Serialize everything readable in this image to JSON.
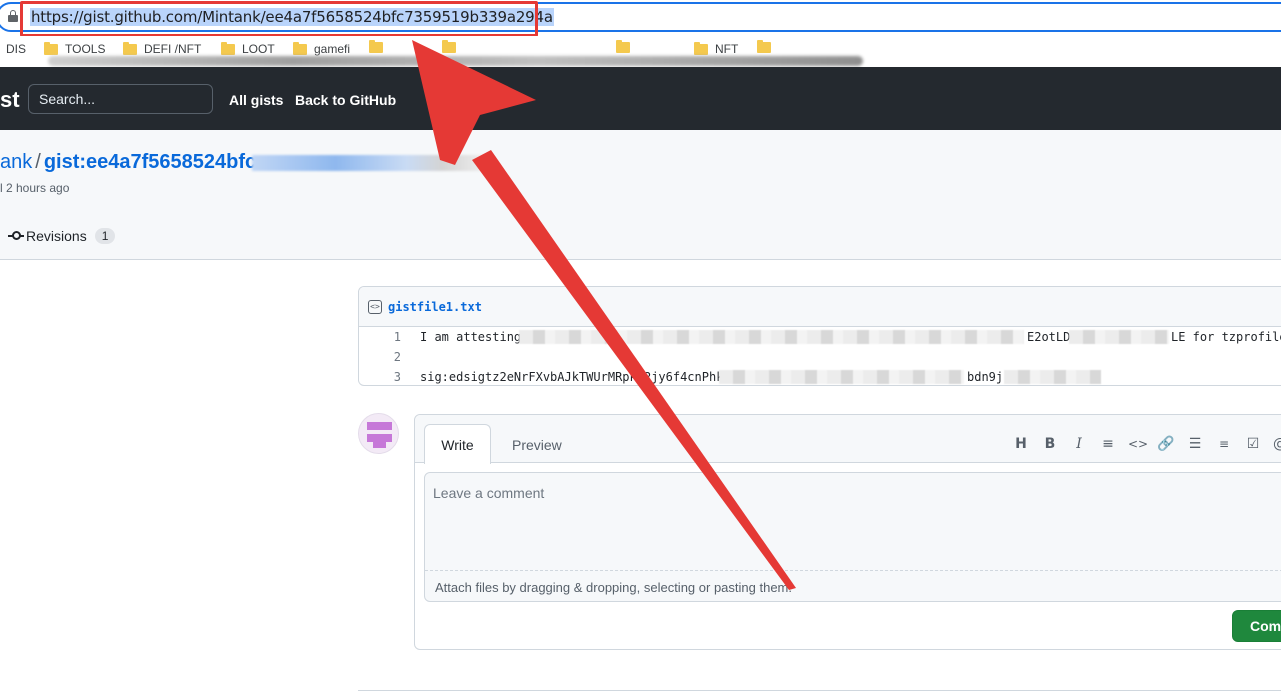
{
  "browser": {
    "url": "https://gist.github.com/Mintank/ee4a7f5658524bfc7359519b339a294a",
    "bookmarks": [
      {
        "label": "DIS",
        "folder": false
      },
      {
        "label": "TOOLS",
        "folder": true
      },
      {
        "label": "DEFI /NFT",
        "folder": true
      },
      {
        "label": "LOOT",
        "folder": true
      },
      {
        "label": "gamefi",
        "folder": true
      },
      {
        "label": "",
        "folder": true
      },
      {
        "label": "",
        "folder": true
      },
      {
        "label": "",
        "folder": true
      },
      {
        "label": "NFT",
        "folder": true
      },
      {
        "label": "",
        "folder": true
      }
    ]
  },
  "header": {
    "logo_text": "st",
    "search_placeholder": "Search...",
    "nav": [
      "All gists",
      "Back to GitHub"
    ]
  },
  "gist": {
    "owner": "ank",
    "separator": "/",
    "name": "gist:ee4a7f5658524bfc",
    "time": "l 2 hours ago",
    "revisions_label": "Revisions",
    "revisions_count": "1"
  },
  "file": {
    "name": "gistfile1.txt",
    "lines": [
      {
        "num": "1",
        "text": "I am attesting “",
        "text_tail": "E2otLD",
        "text_end": "LE for tzprofiles"
      },
      {
        "num": "2",
        "text": ""
      },
      {
        "num": "3",
        "text": "sig:edsigtz2eNrFXvbAJkTWUrMRpkU2jy6f4cnPhkE",
        "text_tail": "bdn9j"
      }
    ]
  },
  "comment": {
    "tab_write": "Write",
    "tab_preview": "Preview",
    "toolbar": [
      "heading-icon",
      "bold-icon",
      "italic-icon",
      "quote-icon",
      "code-icon",
      "link-icon",
      "unordered-list-icon",
      "ordered-list-icon",
      "task-list-icon",
      "mention-icon"
    ],
    "placeholder": "Leave a comment",
    "attach_hint": "Attach files by dragging & dropping, selecting or pasting them.",
    "submit_label": "Comm"
  },
  "colors": {
    "header_bg": "#24292f",
    "link": "#0969da",
    "primary_button": "#1f883d",
    "annotation": "#e53935"
  }
}
